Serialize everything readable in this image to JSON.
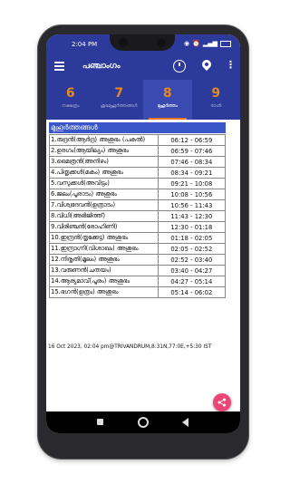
{
  "status_bar": {
    "time": "2:04 PM",
    "icons": [
      "wifi-icon",
      "alarm-icon",
      "signal-icon",
      "battery-icon"
    ]
  },
  "app_bar": {
    "title": "പഞ്ചാംഗം"
  },
  "tabs": [
    {
      "num": "6",
      "label": "നക്ഷത്രം",
      "active": false
    },
    {
      "num": "7",
      "label": "ശുഭമുഹൂർത്തങ്ങൾ",
      "active": false
    },
    {
      "num": "8",
      "label": "മുഹൂർത്തം",
      "active": true
    },
    {
      "num": "9",
      "label": "രാശി",
      "active": false
    }
  ],
  "section": {
    "title": "മുഹൂർത്തങ്ങൾ"
  },
  "muhurtham_rows": [
    {
      "name": "1.രുദ്രൻ(ആർദ്ര) അശുഭം (പകൽ)",
      "time": "06:12 - 06:59"
    },
    {
      "name": "2.ഉരഗം(ആയില്യം) അശുഭം",
      "time": "06:59 - 07:46"
    },
    {
      "name": "3.മൈത്രൻ(അനിഴം)",
      "time": "07:46 - 08:34"
    },
    {
      "name": "4.പിതൃക്കൾ(മകം) അശുഭം",
      "time": "08:34 - 09:21"
    },
    {
      "name": "5.വസുക്കൾ(അവിട്ടം)",
      "time": "09:21 - 10:08"
    },
    {
      "name": "6.ജലം(പൂരാടം) അശുഭം",
      "time": "10:08 - 10:56"
    },
    {
      "name": "7.വിശ്വദേവൻ(ഉത്രാടം)",
      "time": "10:56 - 11:43"
    },
    {
      "name": "8.വിധി(അഭിജിത്ത്)",
      "time": "11:43 - 12:30"
    },
    {
      "name": "9.വിരിഞ്ചൻ(രോഹിണി)",
      "time": "12:30 - 01:18"
    },
    {
      "name": "10.ഇന്ദ്രൻ(തൃക്കേട്ട) അശുഭം",
      "time": "01:18 - 02:05"
    },
    {
      "name": "11.ഇന്ദ്രാഗ്നി(വിശാഖം) അശുഭം",
      "time": "02:05 - 02:52"
    },
    {
      "name": "12.നിരൃതി(മൂലം) അശുഭം",
      "time": "02:52 - 03:40"
    },
    {
      "name": "13.വരുണൻ(ചതയം)",
      "time": "03:40 - 04:27"
    },
    {
      "name": "14.ആര്യമാവ്(പൂരം) അശുഭം",
      "time": "04:27 - 05:14"
    },
    {
      "name": "15.ഭഗൻ(ഉത്രം) അശുഭം",
      "time": "05:14 - 06:02"
    }
  ],
  "footer": {
    "text": "16 Oct 2023, 02:04 pm@TRIVANDRUM,8:31N,77:0E,+5:30 IST"
  },
  "colors": {
    "primary": "#2c3a9c",
    "accent": "#e58a1e",
    "fab": "#ee4577",
    "section": "#3a56c8"
  }
}
